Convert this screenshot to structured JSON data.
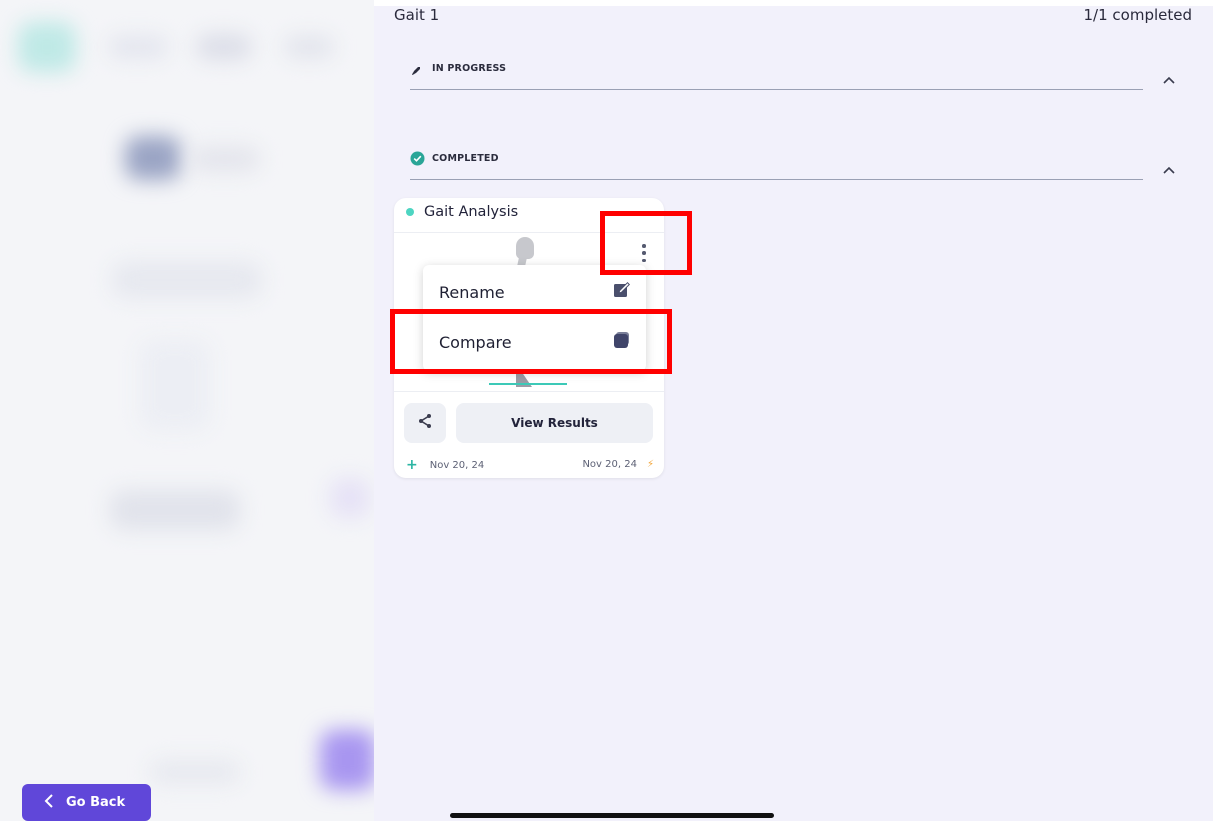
{
  "panel": {
    "title": "Gait 1",
    "count": "1/1 completed"
  },
  "sections": {
    "in_progress": {
      "label": "IN PROGRESS",
      "icon": "rocket-icon"
    },
    "completed": {
      "label": "COMPLETED",
      "icon": "check-circle-icon"
    }
  },
  "card": {
    "title": "Gait Analysis",
    "view_results_label": "View Results",
    "created_date": "Nov 20, 24",
    "updated_date": "Nov 20, 24"
  },
  "menu": {
    "items": [
      {
        "label": "Rename",
        "icon": "edit-icon"
      },
      {
        "label": "Compare",
        "icon": "layers-icon"
      }
    ]
  },
  "footer": {
    "go_back_label": "Go Back"
  },
  "colors": {
    "accent": "#6047d9",
    "teal": "#4dd5c2",
    "highlight": "#ff0000",
    "panel_bg": "#f2f1fb"
  }
}
